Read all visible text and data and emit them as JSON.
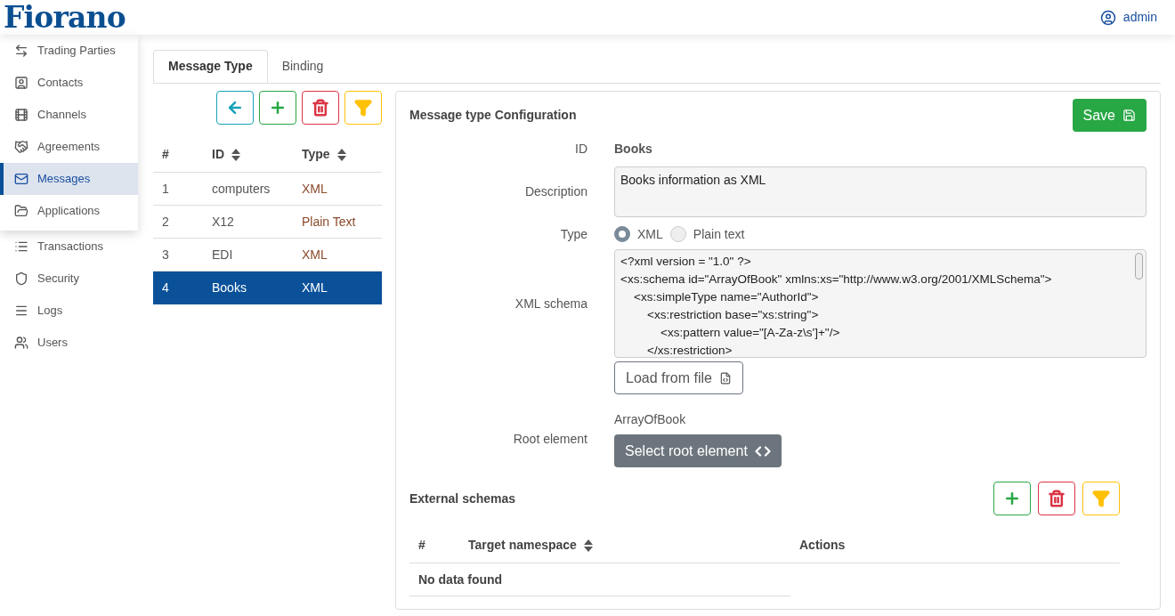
{
  "header": {
    "logo": "Fiorano",
    "user": "admin"
  },
  "sidebar": {
    "items": [
      {
        "label": "Trading Parties",
        "selected": false
      },
      {
        "label": "Contacts",
        "selected": false
      },
      {
        "label": "Channels",
        "selected": false
      },
      {
        "label": "Agreements",
        "selected": false
      },
      {
        "label": "Messages",
        "selected": true
      },
      {
        "label": "Applications",
        "selected": false
      },
      {
        "label": "Transactions",
        "selected": false
      },
      {
        "label": "Security",
        "selected": false
      },
      {
        "label": "Logs",
        "selected": false
      },
      {
        "label": "Users",
        "selected": false
      }
    ]
  },
  "tabs": [
    {
      "label": "Message Type",
      "selected": true
    },
    {
      "label": "Binding",
      "selected": false
    }
  ],
  "list_table": {
    "columns": [
      "#",
      "ID",
      "Type"
    ],
    "rows": [
      {
        "cells": [
          "1",
          "computers",
          "XML"
        ],
        "selected": false
      },
      {
        "cells": [
          "2",
          "X12",
          "Plain Text"
        ],
        "selected": false
      },
      {
        "cells": [
          "3",
          "EDI",
          "XML"
        ],
        "selected": false
      },
      {
        "cells": [
          "4",
          "Books",
          "XML"
        ],
        "selected": true
      }
    ]
  },
  "config": {
    "title": "Message type Configuration",
    "save": "Save",
    "id_label": "ID",
    "id_value": "Books",
    "description_label": "Description",
    "description_value": "Books information as XML",
    "type_label": "Type",
    "type_options": [
      {
        "label": "XML",
        "selected": true
      },
      {
        "label": "Plain text",
        "selected": false
      }
    ],
    "schema_label": "XML schema",
    "schema_lines": [
      "<?xml version = \"1.0\" ?>",
      "<xs:schema id=\"ArrayOfBook\" xmlns:xs=\"http://www.w3.org/2001/XMLSchema\">",
      "    <xs:simpleType name=\"AuthorId\">",
      "        <xs:restriction base=\"xs:string\">",
      "            <xs:pattern value=\"[A-Za-z\\s']+\"/>",
      "        </xs:restriction>"
    ],
    "load_button": "Load from file",
    "root_label": "Root element",
    "root_value": "ArrayOfBook",
    "root_button": "Select root element",
    "external": {
      "title": "External schemas",
      "columns": [
        "#",
        "Target namespace",
        "Actions"
      ],
      "empty": "No data found"
    }
  }
}
